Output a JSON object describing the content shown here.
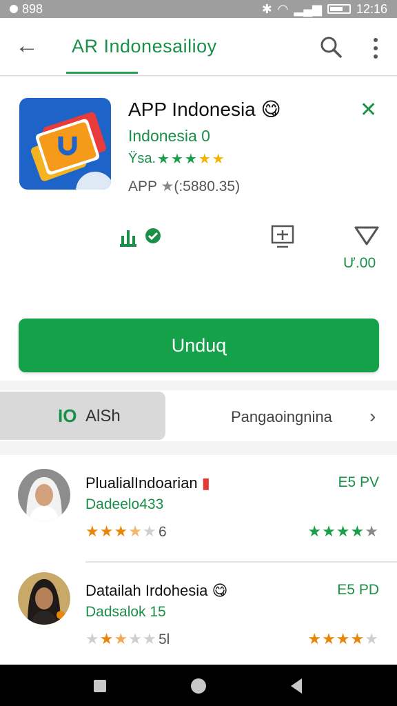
{
  "status": {
    "left_text": "898",
    "time": "12:16"
  },
  "appbar": {
    "title": "AR  Indonesailioy"
  },
  "app": {
    "name": "APP Indonesia",
    "developer": "Indonesia  0",
    "rating_prefix": "Ϋsa.",
    "rating_stars": 5,
    "meta_prefix": "APP",
    "meta_value": "(:5880.35)",
    "stat_value": "Ư.00",
    "install_label": "Unduɋ"
  },
  "tabs": {
    "active_icon": "IO",
    "active_label": "AlSh",
    "second_label": "Pangaoingnina"
  },
  "reviews": [
    {
      "name": "PlualialIndoarian",
      "subtitle": "Dadeelo433",
      "date": "E5 PV",
      "count": "6",
      "left_rating": 3.5,
      "right_rating": 4.5
    },
    {
      "name": "Datailah Irdohesia",
      "subtitle": "Dadsalok 15",
      "date": "E5 PD",
      "count": "5l",
      "left_rating": 2.5,
      "right_rating": 4
    }
  ],
  "colors": {
    "accent_green": "#14a14a",
    "text_green": "#1a8f48",
    "star_orange": "#e8860a",
    "app_icon_blue": "#1e63c8"
  },
  "icons": {
    "back": "arrow-back-icon",
    "search": "search-icon",
    "more": "more-vert-icon",
    "close": "close-icon",
    "download_verified": "download-verified-icon",
    "display": "display-icon",
    "wishlist": "heart-outline-icon",
    "chevron": "chevron-right-icon"
  }
}
